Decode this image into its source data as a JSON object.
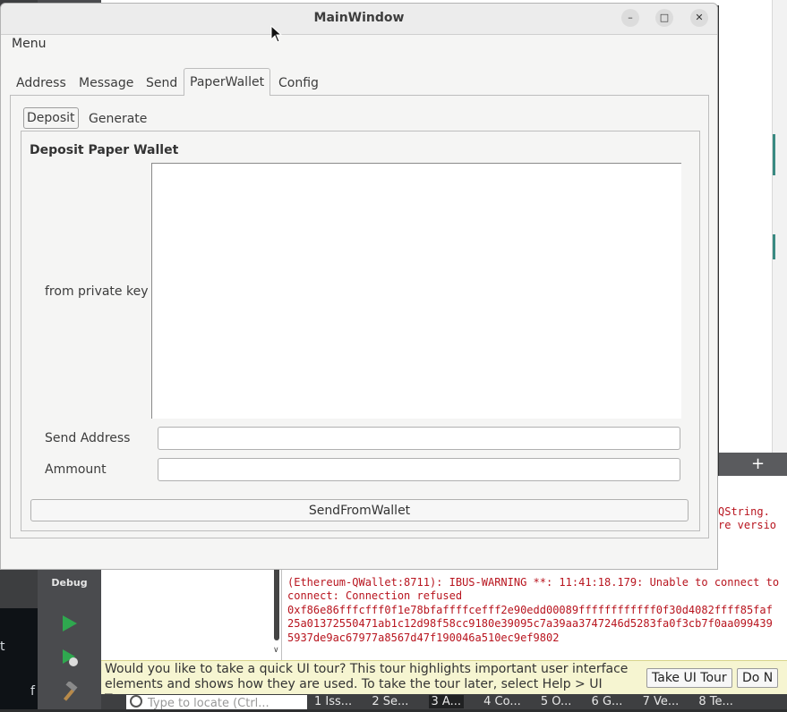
{
  "window": {
    "title": "MainWindow",
    "menu": "Menu",
    "tabs": [
      "Address",
      "Message",
      "Send",
      "PaperWallet",
      "Config"
    ],
    "active_tab": "PaperWallet",
    "subtabs": [
      "Deposit",
      "Generate"
    ],
    "active_subtab": "Deposit",
    "group_title": "Deposit Paper Wallet",
    "form": {
      "private_key_label": "from private key",
      "private_key_value": "",
      "send_address_label": "Send Address",
      "send_address_value": "",
      "amount_label": "Ammount",
      "amount_value": ""
    },
    "send_button": "SendFromWallet"
  },
  "ide": {
    "mode_label": "Debug",
    "output_lines": [
      "(Ethereum-QWallet:8711): IBUS-WARNING **: 11:41:18.179: Unable to connect to",
      "connect: Connection refused",
      "0xf86e86fffcfff0f1e78bfaffffcefff2e90edd00089ffffffffffff0f30d4082ffff85faf",
      "25a01372550471ab1c12d98f58cc9180e39095c7a39aa3747246d5283fa0f3cb7f0aa099439",
      "5937de9ac67977a8567d47f190046a510ec9ef9802"
    ],
    "output_side_lines": [
      "QString.",
      "re versio"
    ],
    "tour_text": "Would you like to take a quick UI tour? This tour highlights important user interface elements and shows how they are used. To take the tour later, select Help > UI Tour.",
    "tour_button": "Take UI Tour",
    "dismiss_button": "Do N",
    "locate_placeholder": "Type to locate (Ctrl...",
    "status_tabs": [
      "1 Iss...",
      "2 Se...",
      "3 A...",
      "4 Co...",
      "5 O...",
      "6 G...",
      "7 Ve...",
      "8 Te..."
    ],
    "left_strip_text": "t",
    "left_strip_text2": "f"
  },
  "colors": {
    "window_bg": "#f5f5f4",
    "tour_bg": "#f6f5d1",
    "output_text": "#b8141e"
  }
}
